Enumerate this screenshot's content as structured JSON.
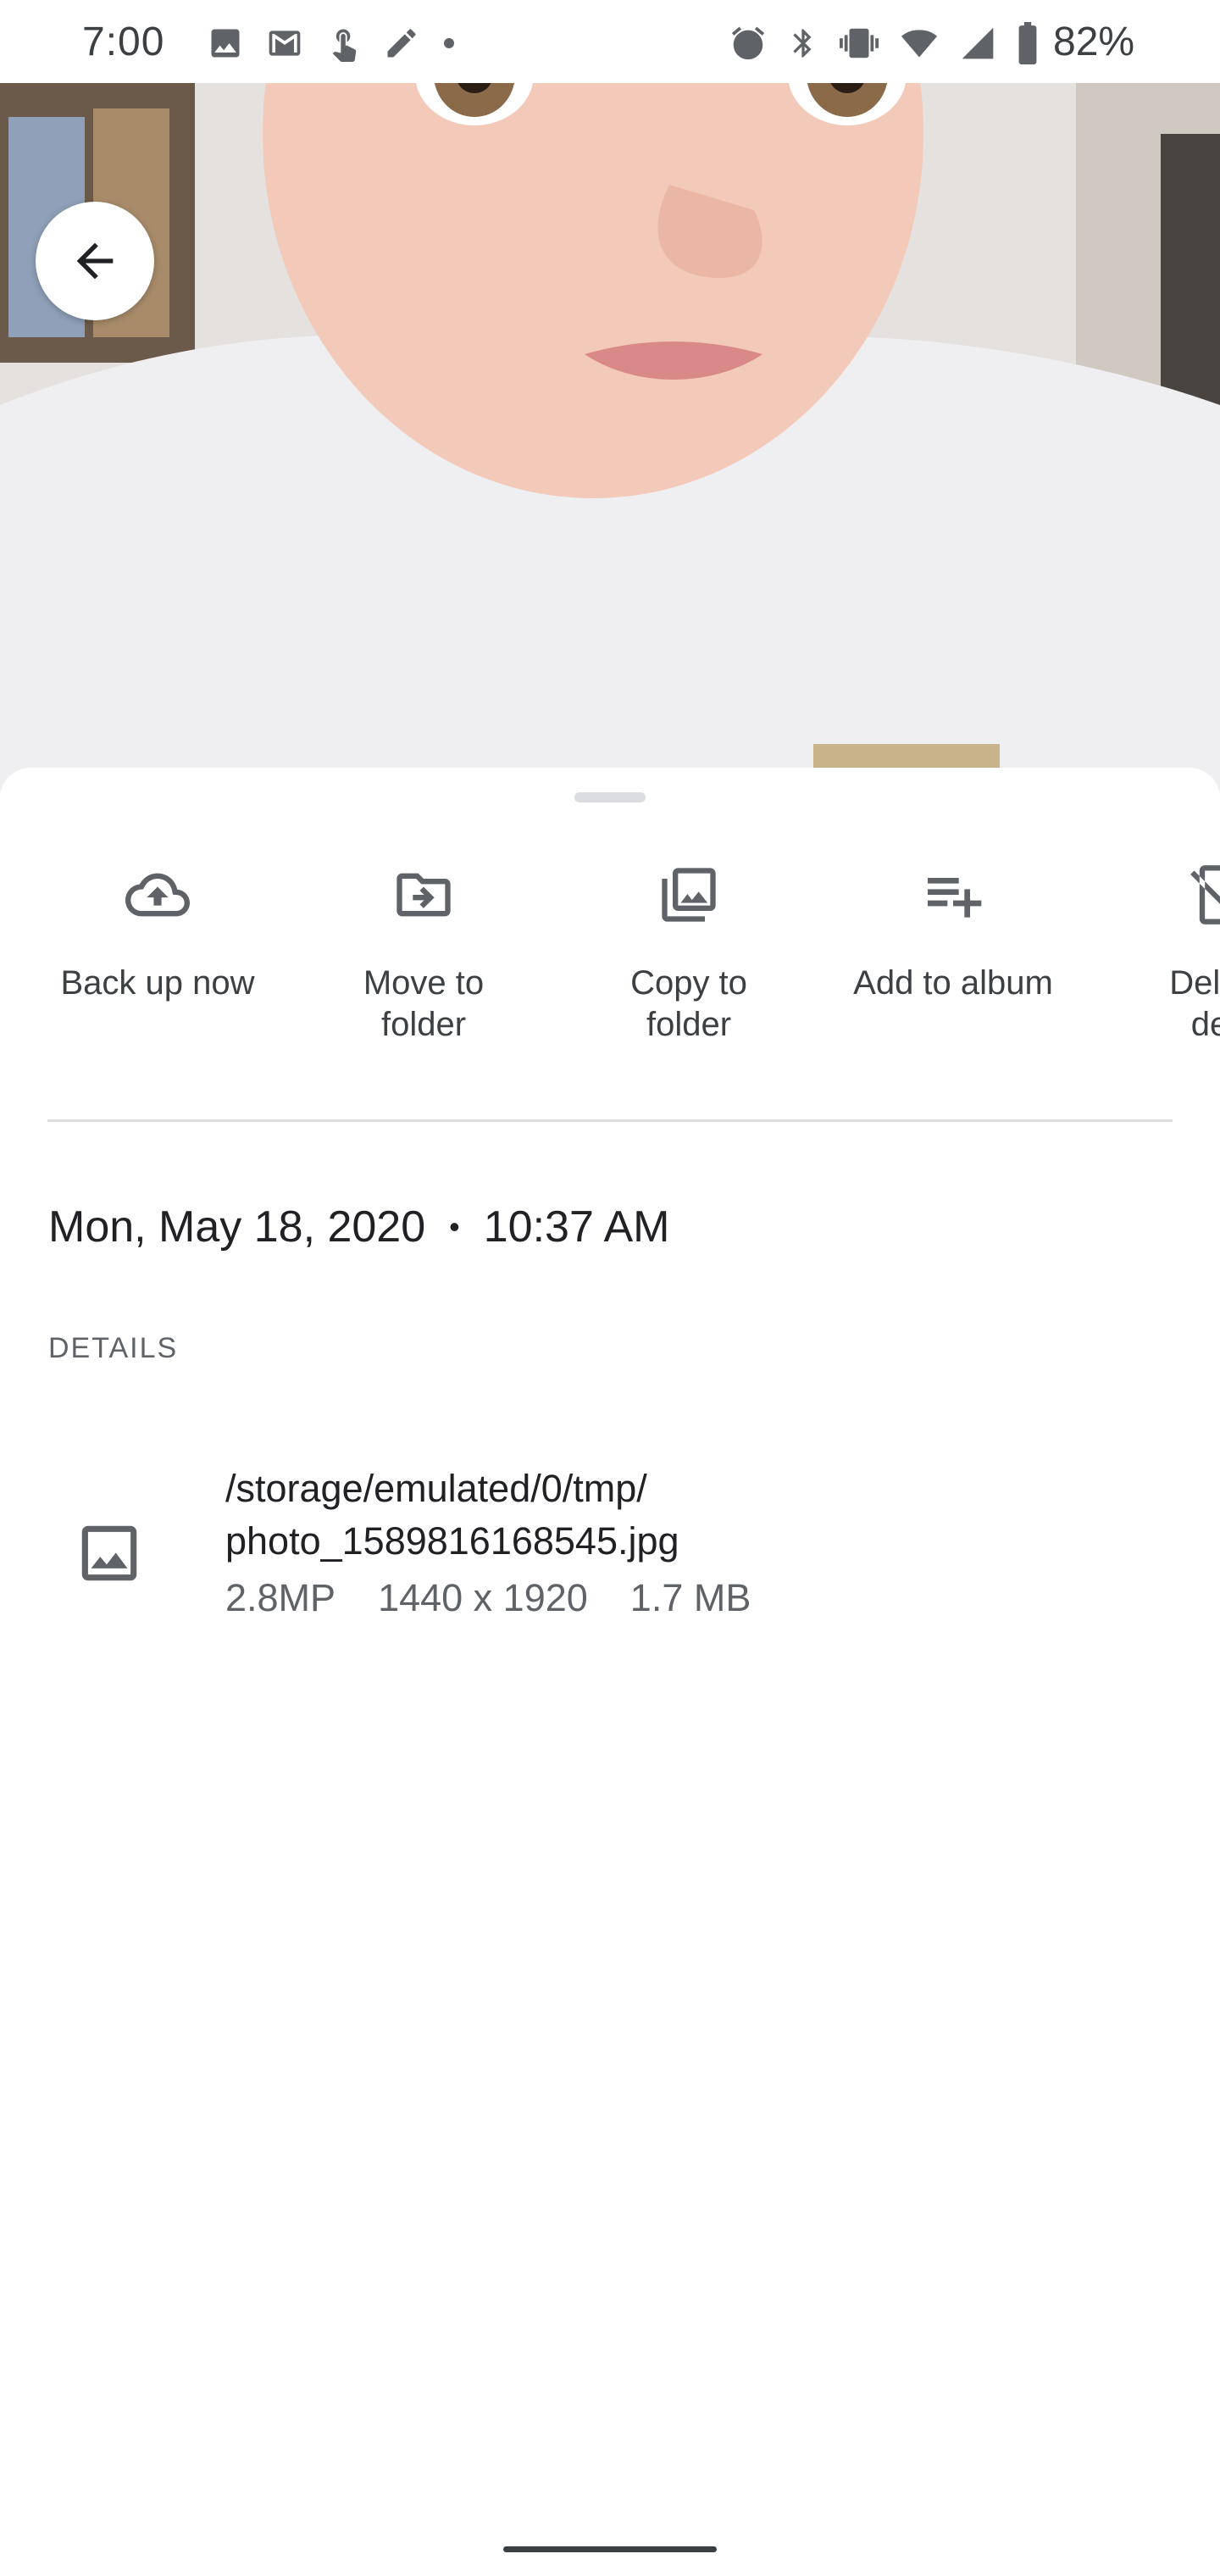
{
  "status_bar": {
    "time": "7:00",
    "left_icons": [
      "image-icon",
      "gmail-icon",
      "touch-icon",
      "pen-icon",
      "dot-icon"
    ],
    "right_icons": [
      "alarm-icon",
      "bluetooth-icon",
      "vibrate-icon",
      "wifi-icon",
      "signal-icon",
      "battery-icon"
    ],
    "battery": "82%"
  },
  "photo": {
    "back_icon": "arrow-back-icon"
  },
  "actions": [
    {
      "label": "Back up now",
      "icon": "cloud-upload-icon"
    },
    {
      "label": "Move to\nfolder",
      "icon": "folder-move-icon"
    },
    {
      "label": "Copy to\nfolder",
      "icon": "photo-library-icon"
    },
    {
      "label": "Add to album",
      "icon": "playlist-add-icon"
    },
    {
      "label": "Delete\ndev",
      "icon": "delete-device-icon"
    }
  ],
  "info": {
    "date": "Mon, May 18, 2020",
    "separator": "•",
    "time": "10:37 AM",
    "details_heading": "DETAILS",
    "file_path": "/storage/emulated/0/tmp/ photo_1589816168545.jpg",
    "megapixels": "2.8MP",
    "dimensions": "1440 x 1920",
    "size": "1.7 MB",
    "file_icon": "image-icon"
  },
  "colors": {
    "text_primary": "#202124",
    "text_secondary": "#5f6368",
    "icon": "#5f6368",
    "divider": "#dadce0"
  }
}
